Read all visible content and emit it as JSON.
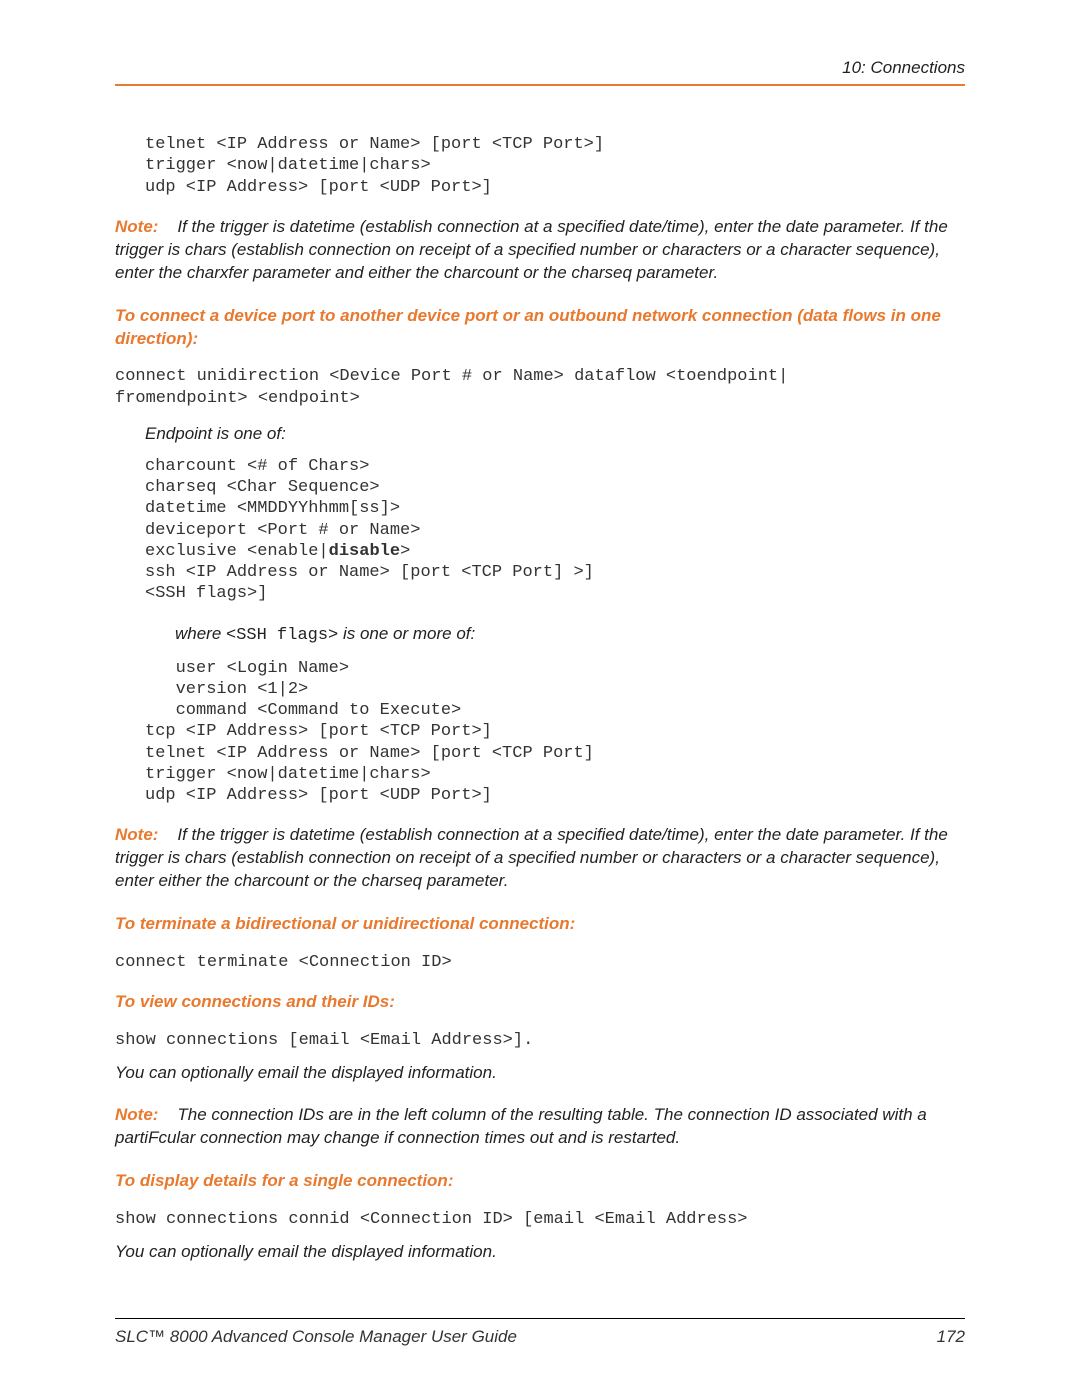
{
  "header": {
    "chapter": "10: Connections"
  },
  "code1_l1": "telnet <IP Address or Name> [port <TCP Port>]",
  "code1_l2": "trigger <now|datetime|chars>",
  "code1_l3": "udp <IP Address> [port <UDP Port>]",
  "note1_label": "Note:",
  "note1_text": "If the trigger is datetime (establish connection at a specified date/time), enter the date parameter. If the trigger is chars (establish connection on receipt of a specified number or characters or a character sequence), enter the charxfer parameter and either the charcount or the charseq parameter.",
  "heading1": "To connect a device port to another device port or an outbound network connection (data flows in one direction):",
  "code2_l1": "connect unidirection <Device Port # or Name> dataflow <toendpoint|",
  "code2_l2": "fromendpoint> <endpoint>",
  "endpoint_label": "Endpoint is one of:",
  "code3_l1": "charcount <# of Chars>",
  "code3_l2": "charseq <Char Sequence>",
  "code3_l3": "datetime <MMDDYYhhmm[ss]>",
  "code3_l4": "deviceport <Port # or Name>",
  "code3_l5a": "exclusive <enable|",
  "code3_l5b": "disable",
  "code3_l5c": ">",
  "code3_l6": "ssh <IP Address or Name> [port <TCP Port] >]",
  "code3_l7": "<SSH flags>]",
  "where_prefix": "where ",
  "where_code": "<SSH flags>",
  "where_suffix": " is one or more of:",
  "code4_l1": "user <Login Name>",
  "code4_l2": "version <1|2>",
  "code4_l3": "command <Command to Execute>",
  "code4_l4": "tcp <IP Address> [port <TCP Port>]",
  "code4_l5": "telnet <IP Address or Name> [port <TCP Port]",
  "code4_l6": "trigger <now|datetime|chars>",
  "code4_l7": "udp <IP Address> [port <UDP Port>]",
  "note2_label": "Note:",
  "note2_text": "If the trigger is datetime (establish connection at a specified date/time), enter the date parameter. If the trigger is chars (establish connection on receipt of a specified number or characters or a character sequence), enter either the charcount or the charseq parameter.",
  "heading2": "To terminate a bidirectional or unidirectional connection:",
  "code5": "connect terminate <Connection ID>",
  "heading3": "To view connections and their IDs:",
  "code6": "show connections [email <Email Address>].",
  "email_info1": "You can optionally email the displayed information.",
  "note3_label": "Note:",
  "note3_text": "The connection IDs are in the left column of the resulting table. The connection ID associated with a partiFcular connection may change if connection times out and is restarted.",
  "heading4": "To display details for a single connection:",
  "code7": "show connections connid <Connection ID> [email <Email Address>",
  "email_info2": "You can optionally email the displayed information.",
  "footer": {
    "title": "SLC™ 8000 Advanced Console Manager User Guide",
    "page": "172"
  }
}
